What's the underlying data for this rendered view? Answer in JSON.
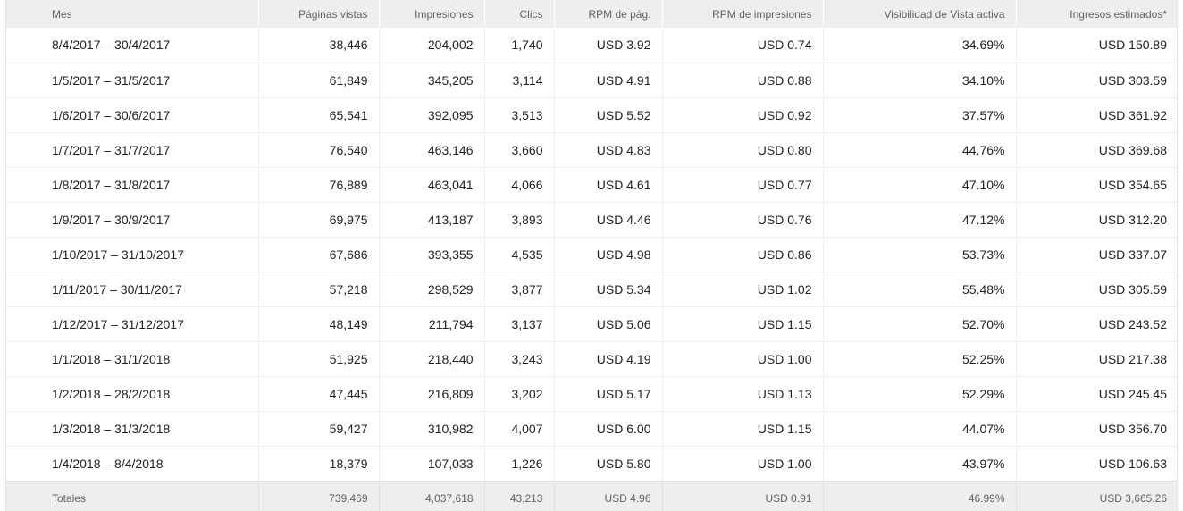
{
  "headers": {
    "mes": "Mes",
    "paginas_vistas": "Páginas vistas",
    "impresiones": "Impresiones",
    "clics": "Clics",
    "rpm_pag": "RPM de pág.",
    "rpm_impresiones": "RPM de impresiones",
    "visibilidad": "Visibilidad de Vista activa",
    "ingresos": "Ingresos estimados*"
  },
  "rows": [
    {
      "mes": "8/4/2017 – 30/4/2017",
      "paginas_vistas": "38,446",
      "impresiones": "204,002",
      "clics": "1,740",
      "rpm_pag": "USD 3.92",
      "rpm_impresiones": "USD 0.74",
      "visibilidad": "34.69%",
      "ingresos": "USD 150.89"
    },
    {
      "mes": "1/5/2017 – 31/5/2017",
      "paginas_vistas": "61,849",
      "impresiones": "345,205",
      "clics": "3,114",
      "rpm_pag": "USD 4.91",
      "rpm_impresiones": "USD 0.88",
      "visibilidad": "34.10%",
      "ingresos": "USD 303.59"
    },
    {
      "mes": "1/6/2017 – 30/6/2017",
      "paginas_vistas": "65,541",
      "impresiones": "392,095",
      "clics": "3,513",
      "rpm_pag": "USD 5.52",
      "rpm_impresiones": "USD 0.92",
      "visibilidad": "37.57%",
      "ingresos": "USD 361.92"
    },
    {
      "mes": "1/7/2017 – 31/7/2017",
      "paginas_vistas": "76,540",
      "impresiones": "463,146",
      "clics": "3,660",
      "rpm_pag": "USD 4.83",
      "rpm_impresiones": "USD 0.80",
      "visibilidad": "44.76%",
      "ingresos": "USD 369.68"
    },
    {
      "mes": "1/8/2017 – 31/8/2017",
      "paginas_vistas": "76,889",
      "impresiones": "463,041",
      "clics": "4,066",
      "rpm_pag": "USD 4.61",
      "rpm_impresiones": "USD 0.77",
      "visibilidad": "47.10%",
      "ingresos": "USD 354.65"
    },
    {
      "mes": "1/9/2017 – 30/9/2017",
      "paginas_vistas": "69,975",
      "impresiones": "413,187",
      "clics": "3,893",
      "rpm_pag": "USD 4.46",
      "rpm_impresiones": "USD 0.76",
      "visibilidad": "47.12%",
      "ingresos": "USD 312.20"
    },
    {
      "mes": "1/10/2017 – 31/10/2017",
      "paginas_vistas": "67,686",
      "impresiones": "393,355",
      "clics": "4,535",
      "rpm_pag": "USD 4.98",
      "rpm_impresiones": "USD 0.86",
      "visibilidad": "53.73%",
      "ingresos": "USD 337.07"
    },
    {
      "mes": "1/11/2017 – 30/11/2017",
      "paginas_vistas": "57,218",
      "impresiones": "298,529",
      "clics": "3,877",
      "rpm_pag": "USD 5.34",
      "rpm_impresiones": "USD 1.02",
      "visibilidad": "55.48%",
      "ingresos": "USD 305.59"
    },
    {
      "mes": "1/12/2017 – 31/12/2017",
      "paginas_vistas": "48,149",
      "impresiones": "211,794",
      "clics": "3,137",
      "rpm_pag": "USD 5.06",
      "rpm_impresiones": "USD 1.15",
      "visibilidad": "52.70%",
      "ingresos": "USD 243.52"
    },
    {
      "mes": "1/1/2018 – 31/1/2018",
      "paginas_vistas": "51,925",
      "impresiones": "218,440",
      "clics": "3,243",
      "rpm_pag": "USD 4.19",
      "rpm_impresiones": "USD 1.00",
      "visibilidad": "52.25%",
      "ingresos": "USD 217.38"
    },
    {
      "mes": "1/2/2018 – 28/2/2018",
      "paginas_vistas": "47,445",
      "impresiones": "216,809",
      "clics": "3,202",
      "rpm_pag": "USD 5.17",
      "rpm_impresiones": "USD 1.13",
      "visibilidad": "52.29%",
      "ingresos": "USD 245.45"
    },
    {
      "mes": "1/3/2018 – 31/3/2018",
      "paginas_vistas": "59,427",
      "impresiones": "310,982",
      "clics": "4,007",
      "rpm_pag": "USD 6.00",
      "rpm_impresiones": "USD 1.15",
      "visibilidad": "44.07%",
      "ingresos": "USD 356.70"
    },
    {
      "mes": "1/4/2018 – 8/4/2018",
      "paginas_vistas": "18,379",
      "impresiones": "107,033",
      "clics": "1,226",
      "rpm_pag": "USD 5.80",
      "rpm_impresiones": "USD 1.00",
      "visibilidad": "43.97%",
      "ingresos": "USD 106.63"
    }
  ],
  "totals": {
    "mes": "Totales",
    "paginas_vistas": "739,469",
    "impresiones": "4,037,618",
    "clics": "43,213",
    "rpm_pag": "USD 4.96",
    "rpm_impresiones": "USD 0.91",
    "visibilidad": "46.99%",
    "ingresos": "USD 3,665.26"
  }
}
